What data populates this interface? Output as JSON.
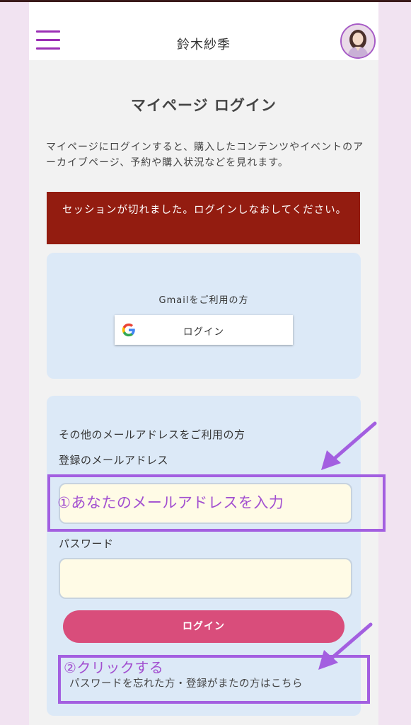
{
  "header": {
    "site_title": "鈴木紗季",
    "menu_icon": "hamburger-menu-icon",
    "avatar": "user-avatar"
  },
  "main": {
    "page_title": "マイページ ログイン",
    "intro_text": "マイページにログインすると、購入したコンテンツやイベントのアーカイブページ、予約や購入状況などを見れます。",
    "error_message": "セッションが切れました。ログインしなおしてください。"
  },
  "gmail_card": {
    "caption": "Gmailをご利用の方",
    "button_label": "ログイン",
    "icon": "google-icon"
  },
  "mail_card": {
    "caption": "その他のメールアドレスをご利用の方",
    "email_label": "登録のメールアドレス",
    "email_value": "",
    "password_label": "パスワード",
    "password_value": "",
    "login_button": "ログイン",
    "forgot_link": "パスワードを忘れた方・登録がまたの方はこちら"
  },
  "annotations": {
    "step1": "①あなたのメールアドレスを入力",
    "step2": "②クリックする",
    "color": "#a24fd0"
  },
  "colors": {
    "accent": "#9b2fb5",
    "error_bg": "#931c10",
    "card_bg": "#dce9f7",
    "input_bg": "#fffbe6",
    "login_button": "#d94d7b",
    "outer_bg": "#f1e3f1"
  }
}
